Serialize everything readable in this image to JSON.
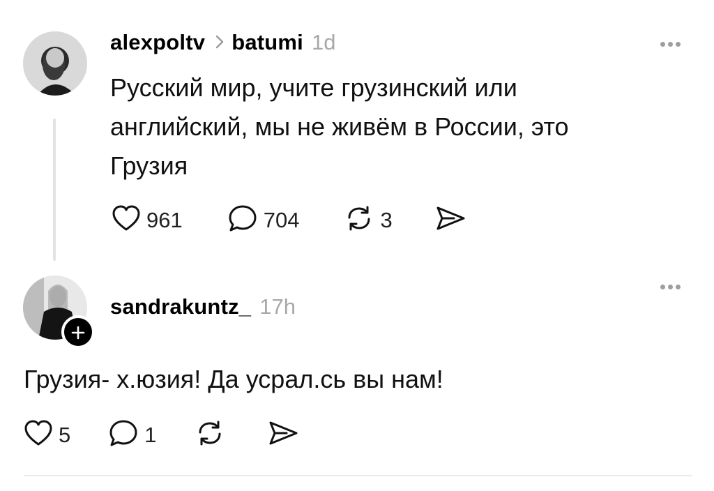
{
  "posts": [
    {
      "username": "alexpoltv",
      "location": "batumi",
      "time": "1d",
      "text_lines": [
        "Русский мир, учите грузинский или",
        "английский, мы не живём в России, это",
        "Грузия"
      ],
      "likes": "961",
      "replies": "704",
      "reposts": "3"
    },
    {
      "username": "sandrakuntz_",
      "time": "17h",
      "text": "Грузия- х.юзия! Да усрал.сь вы нам!",
      "likes": "5",
      "replies": "1"
    }
  ],
  "icons": {
    "like": "heart-icon",
    "reply": "comment-icon",
    "repost": "repost-icon",
    "share": "send-icon",
    "more": "more-icon",
    "chevron": "chevron-right-icon",
    "follow": "plus-icon"
  },
  "colors": {
    "text": "#000000",
    "muted": "#a8a8a8",
    "thread_line": "#e3e3e3"
  }
}
